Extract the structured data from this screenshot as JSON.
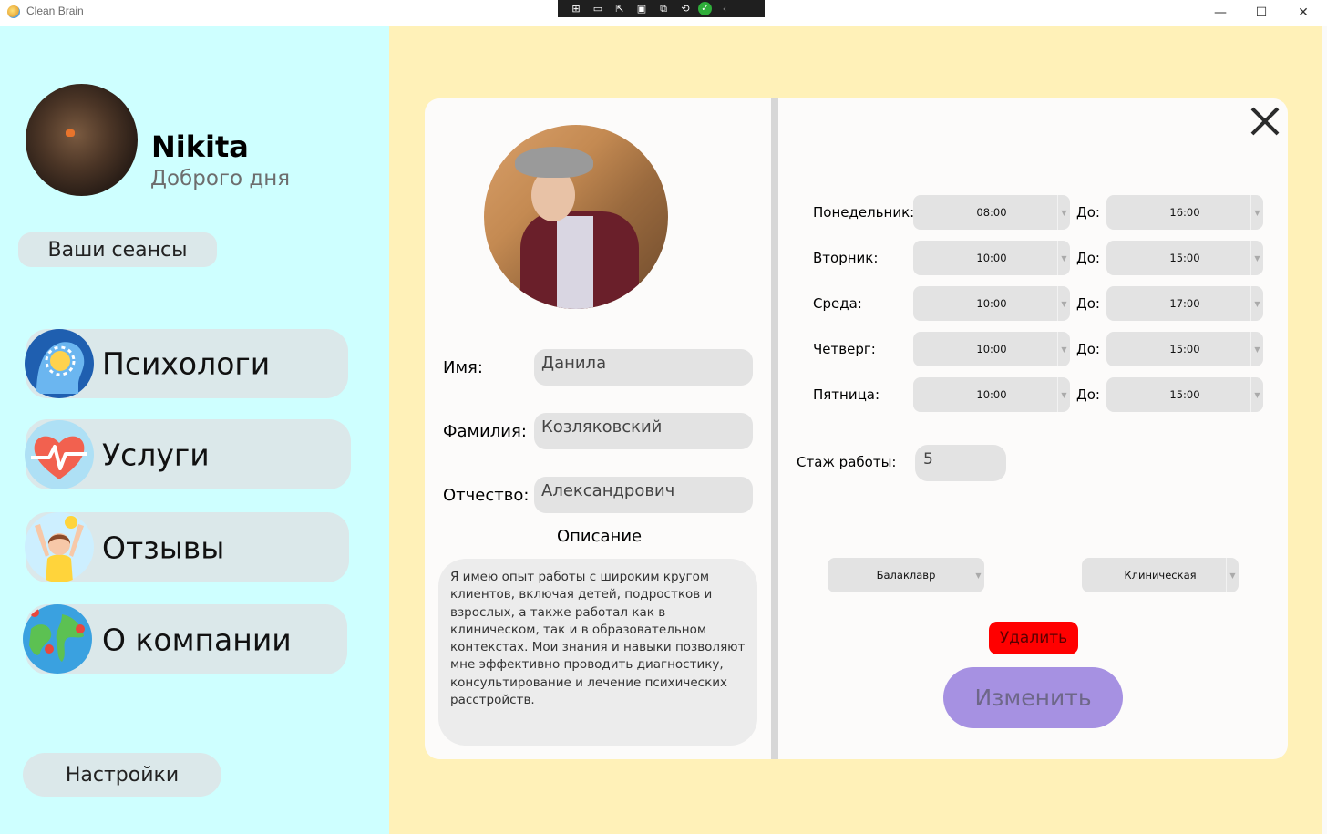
{
  "window": {
    "title": "Clean Brain",
    "minimize_label": "—",
    "maximize_label": "☐",
    "close_label": "✕"
  },
  "sidebar": {
    "user_name": "Nikita",
    "greeting": "Доброго дня",
    "sessions_label": "Ваши сеансы",
    "settings_label": "Настройки",
    "nav": [
      {
        "label": "Психологи",
        "icon": "psychology-head-icon"
      },
      {
        "label": "Услуги",
        "icon": "heart-pulse-icon"
      },
      {
        "label": "Отзывы",
        "icon": "happy-person-icon"
      },
      {
        "label": "О компании",
        "icon": "globe-pins-icon"
      }
    ]
  },
  "profile": {
    "name_label": "Имя:",
    "name_value": "Данила",
    "surname_label": "Фамилия:",
    "surname_value": "Козляковский",
    "patronymic_label": "Отчество:",
    "patronymic_value": "Александрович",
    "description_title": "Описание",
    "description": "Я имею опыт работы с широким кругом клиентов, включая детей, подростков и взрослых, а также работал как в клиническом, так и в образовательном контекстах. Мои знания и навыки позволяют мне эффективно проводить диагностику, консультирование и лечение психических расстройств."
  },
  "schedule": {
    "to_label": "До:",
    "days": [
      {
        "day": "Понедельник:",
        "from": "08:00",
        "to": "16:00"
      },
      {
        "day": "Вторник:",
        "from": "10:00",
        "to": "15:00"
      },
      {
        "day": "Среда:",
        "from": "10:00",
        "to": "17:00"
      },
      {
        "day": "Четверг:",
        "from": "10:00",
        "to": "15:00"
      },
      {
        "day": "Пятница:",
        "from": "10:00",
        "to": "15:00"
      }
    ]
  },
  "experience": {
    "label": "Стаж работы:",
    "value": "5"
  },
  "qualifications": {
    "degree": "Балаклавр",
    "specialization": "Клиническая"
  },
  "actions": {
    "delete_label": "Удалить",
    "edit_label": "Изменить"
  },
  "colors": {
    "sidebar_bg": "#ceffff",
    "main_bg": "#fff1b8",
    "delete": "#ff0000",
    "edit": "#a691e2"
  }
}
